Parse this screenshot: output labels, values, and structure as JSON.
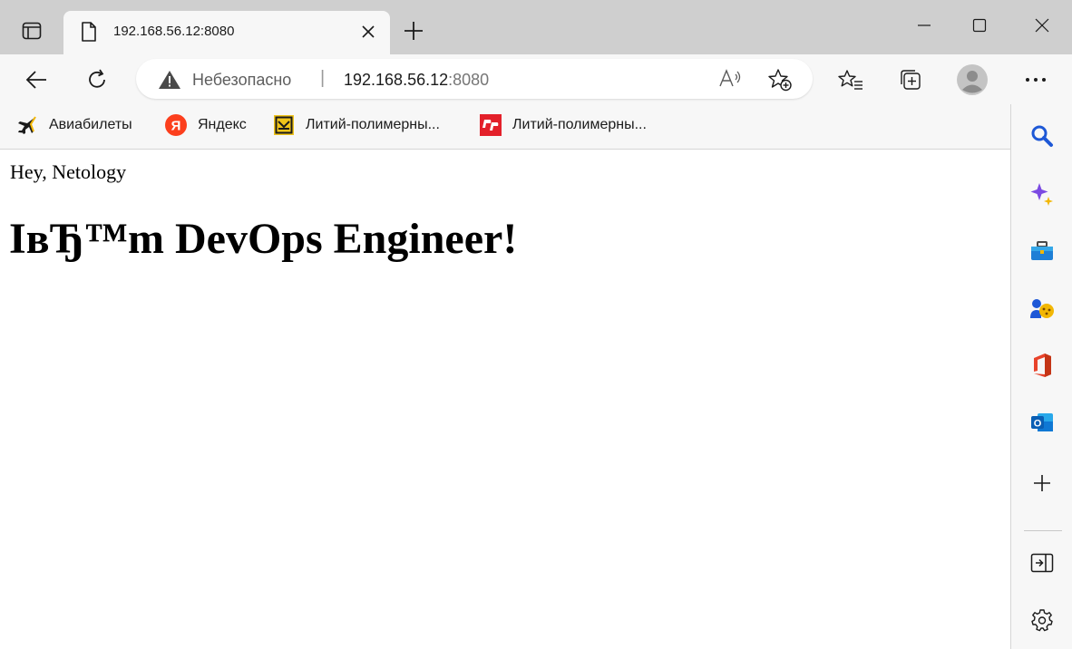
{
  "tab": {
    "title": "192.168.56.12:8080",
    "close_glyph": "✕"
  },
  "new_tab_glyph": "+",
  "window": {
    "minimize_label": "Minimize",
    "maximize_label": "Maximize",
    "close_label": "Close"
  },
  "omnibox": {
    "security_label": "Небезопасно",
    "separator": "|",
    "host": "192.168.56.12",
    "port": ":8080"
  },
  "favorites": [
    {
      "label": "Авиабилеты",
      "icon": "airplane-icon"
    },
    {
      "label": "Яндекс",
      "icon": "yandex-icon"
    },
    {
      "label": "Литий-полимерны...",
      "icon": "battery-site-icon"
    },
    {
      "label": "Литий-полимерны...",
      "icon": "red-logo-icon"
    }
  ],
  "page": {
    "greeting": "Hey, Netology",
    "heading": "IвЂ™m DevOps Engineer!"
  },
  "colors": {
    "tabstrip": "#cfcfcf",
    "toolbar": "#f7f7f7",
    "accent_blue": "#1e58d6",
    "sidebar_purple": "#7b4ae2"
  }
}
